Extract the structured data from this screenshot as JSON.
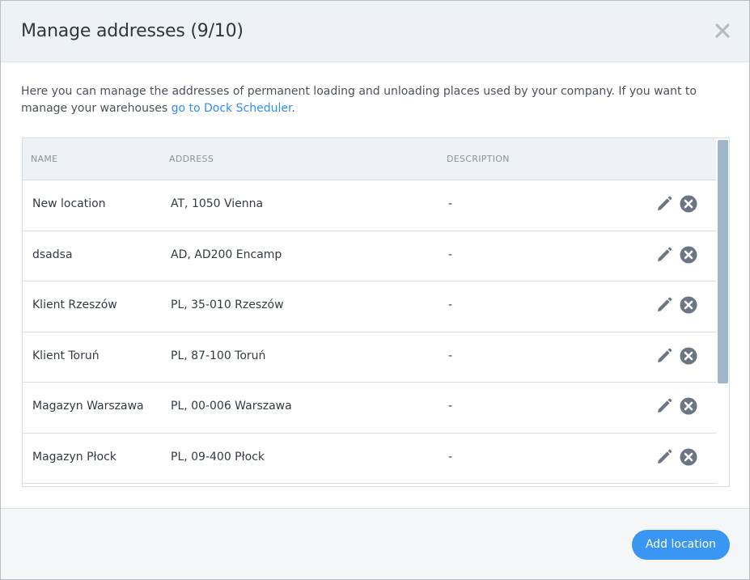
{
  "header": {
    "title": "Manage addresses (9/10)"
  },
  "intro": {
    "text": "Here you can manage the addresses of permanent loading and unloading places used by your company. If you want to manage your warehouses ",
    "link": "go to Dock Scheduler",
    "suffix": "."
  },
  "table": {
    "columns": {
      "name": "NAME",
      "address": "ADDRESS",
      "description": "DESCRIPTION"
    },
    "rows": [
      {
        "name": "New location",
        "address": "AT, 1050 Vienna",
        "description": "-"
      },
      {
        "name": "dsadsa",
        "address": "AD, AD200 Encamp",
        "description": "-"
      },
      {
        "name": "Klient Rzeszów",
        "address": "PL, 35-010 Rzeszów",
        "description": "-"
      },
      {
        "name": "Klient Toruń",
        "address": "PL, 87-100 Toruń",
        "description": "-"
      },
      {
        "name": "Magazyn Warszawa",
        "address": "PL, 00-006 Warszawa",
        "description": "-"
      },
      {
        "name": "Magazyn Płock",
        "address": "PL, 09-400 Płock",
        "description": "-"
      }
    ]
  },
  "footer": {
    "add_label": "Add location"
  },
  "icons": {
    "close": "close-icon",
    "edit": "pencil-icon",
    "delete": "delete-circle-icon"
  },
  "colors": {
    "accent": "#3a96f3",
    "link": "#2f8ef2",
    "icon": "#6b7584",
    "scroll_thumb": "#9fb6cb"
  }
}
